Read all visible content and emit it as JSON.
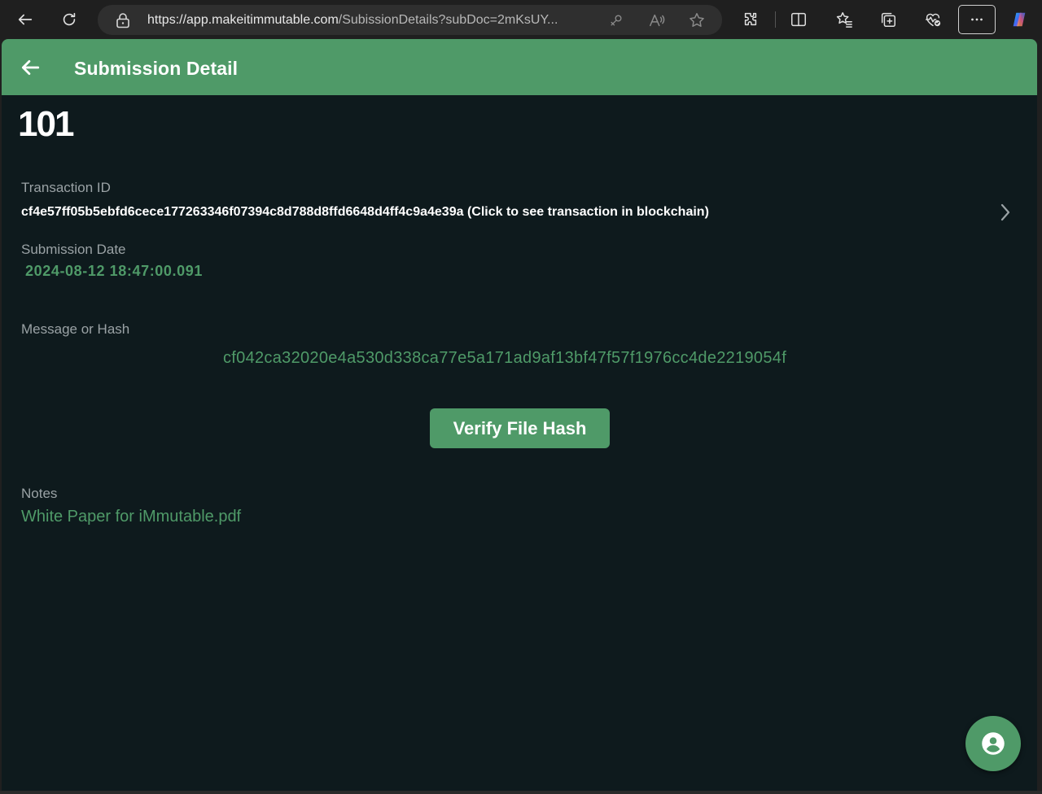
{
  "browser": {
    "url_host": "https://app.makeitimmutable.com",
    "url_path": "/SubissionDetails?subDoc=2mKsUY..."
  },
  "header": {
    "title": "Submission Detail"
  },
  "submission": {
    "title": "101",
    "transaction_label": "Transaction ID",
    "transaction_value": "cf4e57ff05b5ebfd6cece177263346f07394c8d788d8ffd6648d4ff4c9a4e39a (Click to see transaction in blockchain)",
    "date_label": "Submission Date",
    "date_value": "2024-08-12 18:47:00.091",
    "hash_label": "Message or Hash",
    "hash_value": "cf042ca32020e4a530d338ca77e5a171ad9af13bf47f57f1976cc4de2219054f",
    "verify_label": "Verify File Hash",
    "notes_label": "Notes",
    "notes_value": "White Paper for iMmutable.pdf"
  },
  "colors": {
    "accent": "#4f9a68",
    "background": "#0e1a1d",
    "label": "#9aa2a5"
  },
  "icons": {
    "browser_back": "back-arrow-icon",
    "browser_refresh": "refresh-icon",
    "lock": "lock-icon",
    "fab": "account-icon"
  }
}
